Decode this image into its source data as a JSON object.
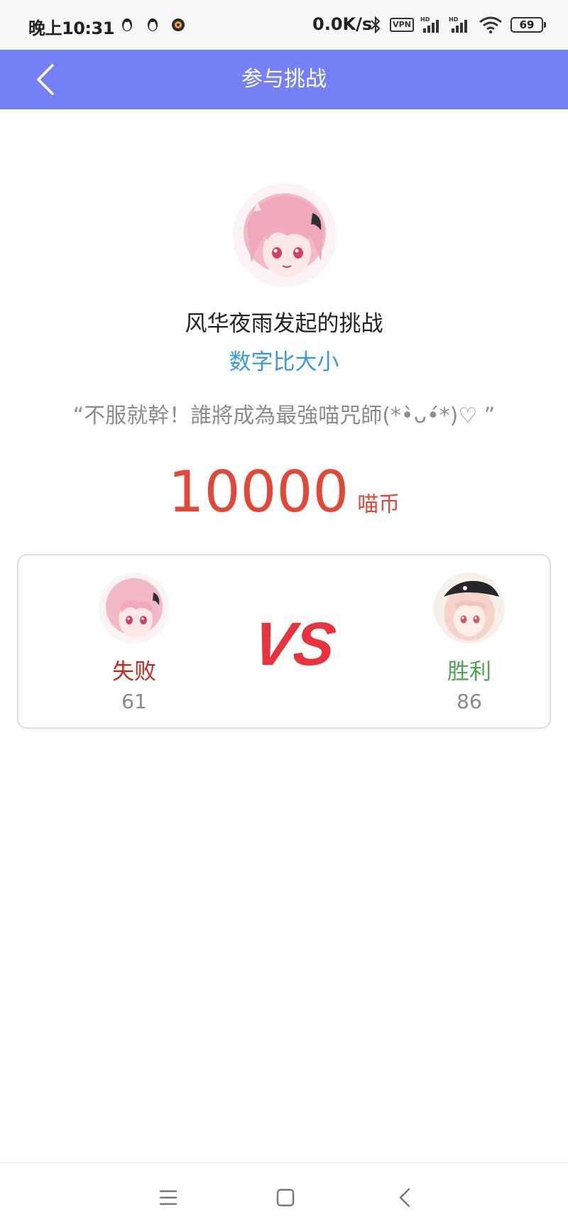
{
  "status_bar": {
    "time": "晚上10:31",
    "net_speed": "0.0K/s",
    "vpn": "VPN",
    "battery": "69"
  },
  "header": {
    "title": "参与挑战",
    "color": "#7680f5"
  },
  "challenge": {
    "initiator_text": "风华夜雨发起的挑战",
    "game_name": "数字比大小",
    "slogan": "“不服就幹！誰將成為最強喵咒師(*•̀ᴗ•́*)♡ ”",
    "stake_amount": "10000",
    "stake_unit": "喵币"
  },
  "vs": {
    "logo_text": "VS",
    "left": {
      "result": "失败",
      "score": "61"
    },
    "right": {
      "result": "胜利",
      "score": "86"
    }
  },
  "colors": {
    "accent": "#7680f5",
    "stake": "#e24838",
    "lose": "#c8261c",
    "win": "#4aa64f",
    "link": "#3a9ad6"
  },
  "icons": {
    "back": "chevron-left-icon",
    "menu": "menu-icon",
    "home": "home-icon",
    "nav_back": "nav-back-icon"
  }
}
